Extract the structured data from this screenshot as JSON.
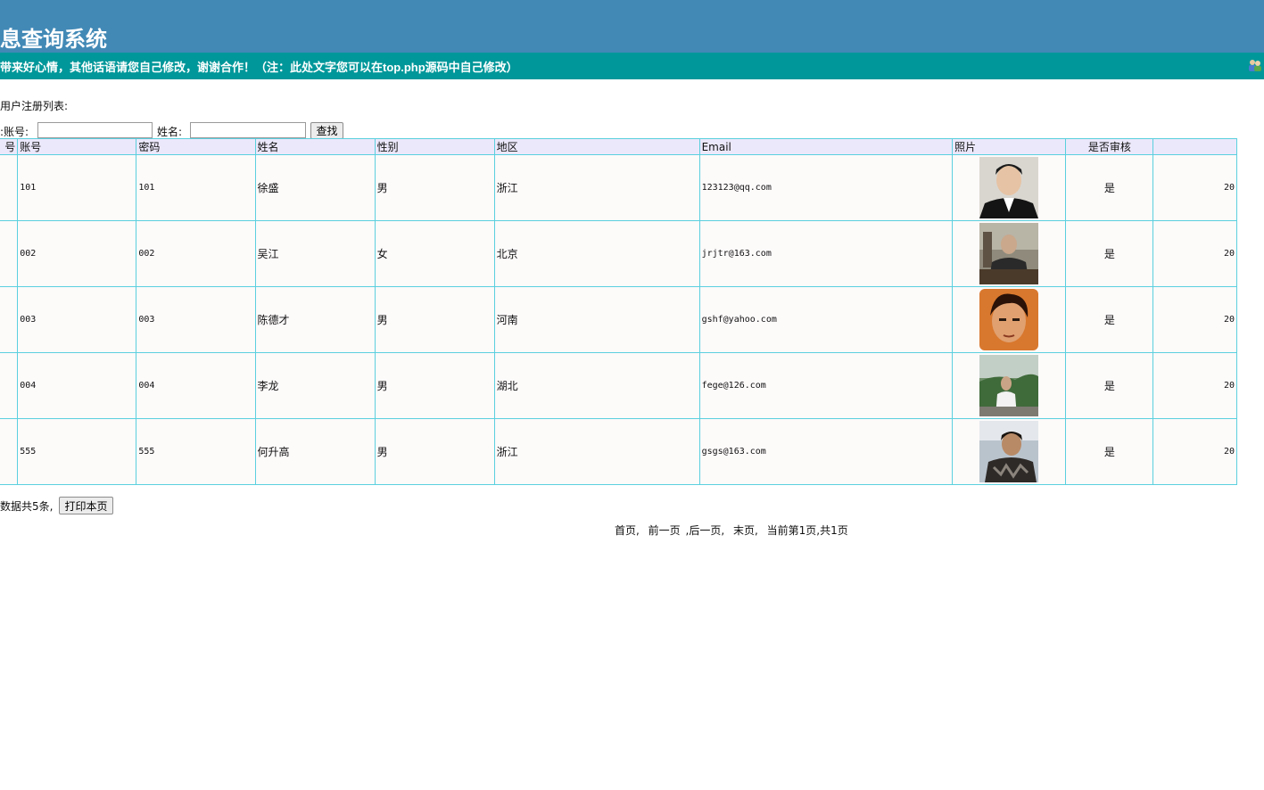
{
  "header": {
    "title": "息查询系统",
    "marquee": "带来好心情，其他话语请您自己修改，谢谢合作！（注：此处文字您可以在top.php源码中自己修改）"
  },
  "list": {
    "heading": "用户注册列表:"
  },
  "search": {
    "account_label": ":账号:",
    "account_value": "",
    "name_label": "姓名:",
    "name_value": "",
    "button": "查找"
  },
  "table": {
    "headers": [
      "号",
      "账号",
      "密码",
      "姓名",
      "性别",
      "地区",
      "Email",
      "照片",
      "是否审核",
      ""
    ],
    "rows": [
      {
        "no": "",
        "account": "101",
        "password": "101",
        "name": "徐盛",
        "gender": "男",
        "region": "浙江",
        "email": "123123@qq.com",
        "approved": "是",
        "date": "20"
      },
      {
        "no": "",
        "account": "002",
        "password": "002",
        "name": "吴江",
        "gender": "女",
        "region": "北京",
        "email": "jrjtr@163.com",
        "approved": "是",
        "date": "20"
      },
      {
        "no": "",
        "account": "003",
        "password": "003",
        "name": "陈德才",
        "gender": "男",
        "region": "河南",
        "email": "gshf@yahoo.com",
        "approved": "是",
        "date": "20"
      },
      {
        "no": "",
        "account": "004",
        "password": "004",
        "name": "李龙",
        "gender": "男",
        "region": "湖北",
        "email": "fege@126.com",
        "approved": "是",
        "date": "20"
      },
      {
        "no": "",
        "account": "555",
        "password": "555",
        "name": "何升高",
        "gender": "男",
        "region": "浙江",
        "email": "gsgs@163.com",
        "approved": "是",
        "date": "20"
      }
    ]
  },
  "footer": {
    "total": "数据共5条,",
    "print_button": "打印本页",
    "first": "首页,",
    "prev": "前一页",
    "next": ",后一页,",
    "last": "末页,",
    "status": "当前第1页,共1页"
  },
  "colors": {
    "title_bar": "#4289b6",
    "marquee_bar": "#00979a",
    "grid_border": "#5ad0de",
    "header_bg": "#ece8fb"
  }
}
